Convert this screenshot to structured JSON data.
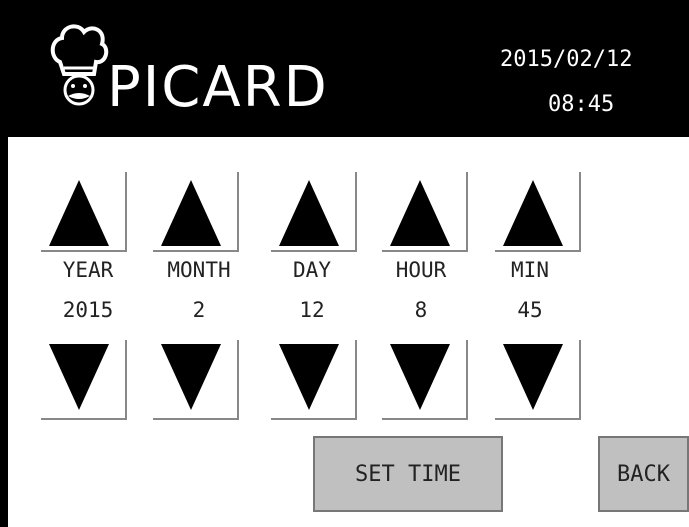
{
  "header": {
    "brand": "PICARD",
    "date": "2015/02/12",
    "time": "08:45",
    "logo_icon": "chef-icon"
  },
  "fields": [
    {
      "label": "YEAR",
      "value": "2015"
    },
    {
      "label": "MONTH",
      "value": "2"
    },
    {
      "label": "DAY",
      "value": "12"
    },
    {
      "label": "HOUR",
      "value": "8"
    },
    {
      "label": "MIN",
      "value": "45"
    }
  ],
  "buttons": {
    "set_time": "SET TIME",
    "back": "BACK",
    "up_icon": "triangle-up-icon",
    "down_icon": "triangle-down-icon"
  },
  "colors": {
    "header_bg": "#000000",
    "button_bg": "#c0c0c0"
  }
}
